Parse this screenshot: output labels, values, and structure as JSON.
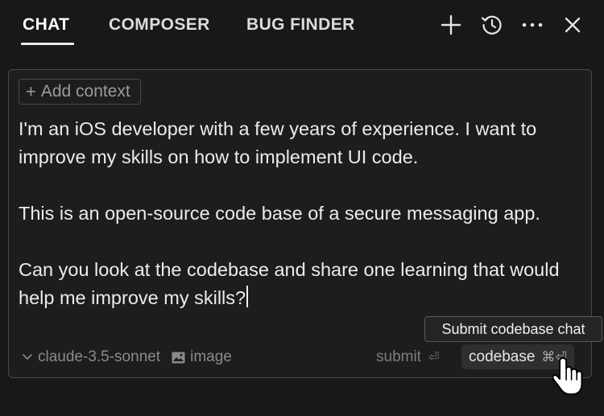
{
  "tabs": [
    {
      "label": "CHAT",
      "active": true
    },
    {
      "label": "COMPOSER",
      "active": false
    },
    {
      "label": "BUG FINDER",
      "active": false
    }
  ],
  "toolbar_icons": [
    "plus-icon",
    "history-icon",
    "more-icon",
    "close-icon"
  ],
  "composer": {
    "add_context_label": "Add context",
    "prompt_paragraphs": [
      "I'm an iOS developer with a few years of experience. I want to improve my skills on how to implement UI code.",
      "This is an open-source code base of a secure messaging app.",
      "Can you look at the codebase and share one learning that would help me improve my skills?"
    ],
    "model": "claude-3.5-sonnet",
    "image_label": "image",
    "submit_label": "submit",
    "submit_shortcut": "⏎",
    "codebase_label": "codebase",
    "codebase_shortcut": "⌘⏎"
  },
  "tooltip": {
    "text": "Submit codebase chat"
  },
  "colors": {
    "background": "#181818",
    "panel": "#1d1d1d",
    "border": "#4a4a4a",
    "text": "#ececec",
    "muted": "#8a8a8a"
  }
}
